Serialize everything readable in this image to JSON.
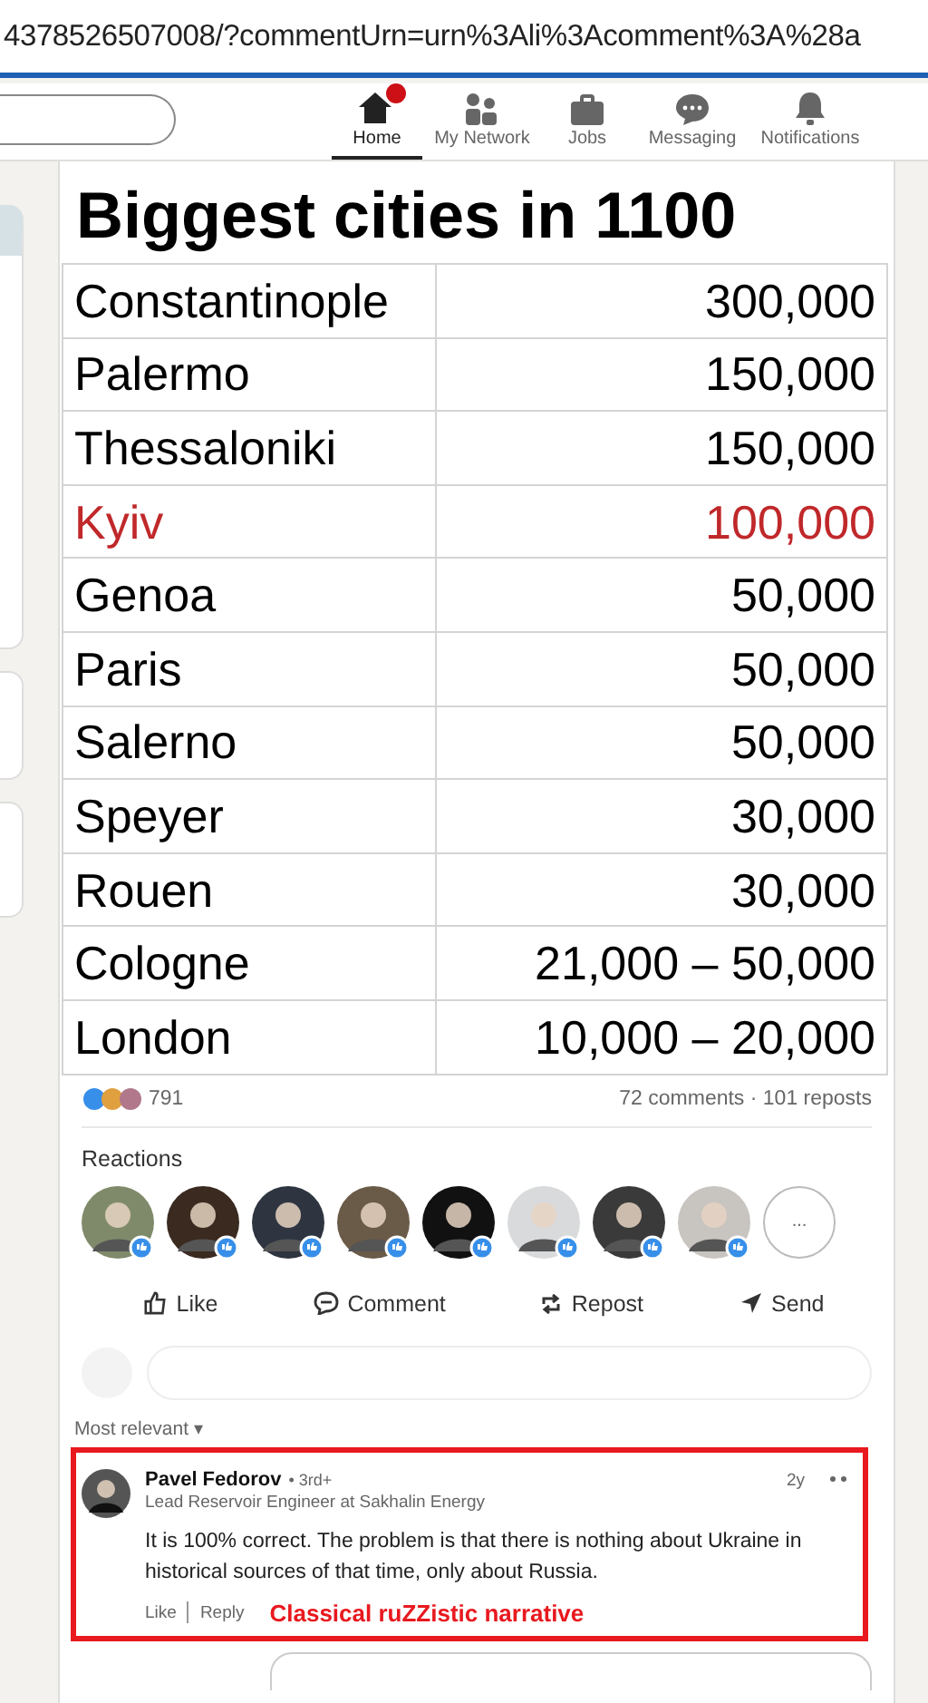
{
  "address_bar": {
    "url": "4378526507008/?commentUrn=urn%3Ali%3Acomment%3A%28a"
  },
  "nav": [
    {
      "label": "Home",
      "kind": "home",
      "selected": true,
      "badge": true
    },
    {
      "label": "My Network",
      "kind": "network",
      "selected": false,
      "badge": false
    },
    {
      "label": "Jobs",
      "kind": "jobs",
      "selected": false,
      "badge": false
    },
    {
      "label": "Messaging",
      "kind": "messaging",
      "selected": false,
      "badge": false
    },
    {
      "label": "Notifications",
      "kind": "notifications",
      "selected": false,
      "badge": false
    }
  ],
  "post_image": {
    "title": "Biggest cities in 1100",
    "rows": [
      {
        "city": "Constantinople",
        "population": "300,000",
        "highlighted": false
      },
      {
        "city": "Palermo",
        "population": "150,000",
        "highlighted": false
      },
      {
        "city": "Thessaloniki",
        "population": "150,000",
        "highlighted": false
      },
      {
        "city": "Kyiv",
        "population": "100,000",
        "highlighted": true
      },
      {
        "city": "Genoa",
        "population": "50,000",
        "highlighted": false
      },
      {
        "city": "Paris",
        "population": "50,000",
        "highlighted": false
      },
      {
        "city": "Salerno",
        "population": "50,000",
        "highlighted": false
      },
      {
        "city": "Speyer",
        "population": "30,000",
        "highlighted": false
      },
      {
        "city": "Rouen",
        "population": "30,000",
        "highlighted": false
      },
      {
        "city": "Cologne",
        "population": "21,000 – 50,000",
        "highlighted": false
      },
      {
        "city": "London",
        "population": "10,000 – 20,000",
        "highlighted": false
      }
    ]
  },
  "social_counts": {
    "reactions": "791",
    "comments_reposts": "72 comments · 101 reposts"
  },
  "reactions": {
    "heading": "Reactions",
    "more": "...",
    "avatars": [
      {
        "color": "#7f8a6a"
      },
      {
        "color": "#3a2a20"
      },
      {
        "color": "#2e3540"
      },
      {
        "color": "#6a5a48"
      },
      {
        "color": "#111111"
      },
      {
        "color": "#d8dadc"
      },
      {
        "color": "#3a3a3a"
      },
      {
        "color": "#c8c4c0"
      }
    ]
  },
  "actions": [
    {
      "label": "Like",
      "kind": "like"
    },
    {
      "label": "Comment",
      "kind": "comment"
    },
    {
      "label": "Repost",
      "kind": "repost"
    },
    {
      "label": "Send",
      "kind": "send"
    }
  ],
  "sort": {
    "label": "Most relevant",
    "caret": "▾"
  },
  "comment": {
    "author": "Pavel Fedorov",
    "degree": "• 3rd+",
    "headline": "Lead Reservoir Engineer at Sakhalin Energy",
    "time": "2y",
    "text": "It is 100% correct. The problem is that there is nothing about Ukraine in historical sources of that time, only about Russia.",
    "actions": [
      "Like",
      "Reply"
    ]
  },
  "annotation": {
    "text": "Classical ruZZistic narrative"
  }
}
